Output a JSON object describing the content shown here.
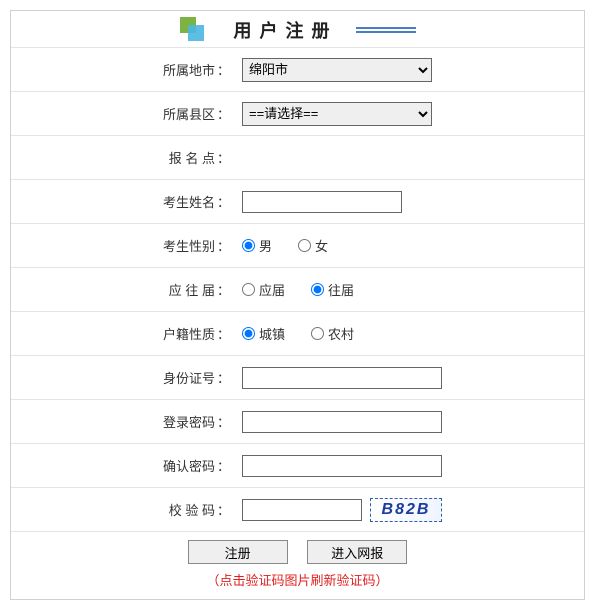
{
  "header": {
    "title": "用户注册"
  },
  "fields": {
    "city_label": "所属地市",
    "city_value": "绵阳市",
    "county_label": "所属县区",
    "county_value": "==请选择==",
    "site_label": "报 名 点",
    "name_label": "考生姓名",
    "name_value": "",
    "gender_label": "考生性别",
    "gender_options": {
      "male": "男",
      "female": "女"
    },
    "gender_selected": "male",
    "grad_label": "应 往 届",
    "grad_options": {
      "current": "应届",
      "past": "往届"
    },
    "grad_selected": "past",
    "hukou_label": "户籍性质",
    "hukou_options": {
      "urban": "城镇",
      "rural": "农村"
    },
    "hukou_selected": "urban",
    "id_label": "身份证号",
    "id_value": "",
    "pwd_label": "登录密码",
    "pwd_value": "",
    "pwd2_label": "确认密码",
    "pwd2_value": "",
    "captcha_label": "校 验 码",
    "captcha_value": "",
    "captcha_text": "B82B"
  },
  "buttons": {
    "register": "注册",
    "enter": "进入网报"
  },
  "hint": "（点击验证码图片刷新验证码）",
  "colon": "："
}
